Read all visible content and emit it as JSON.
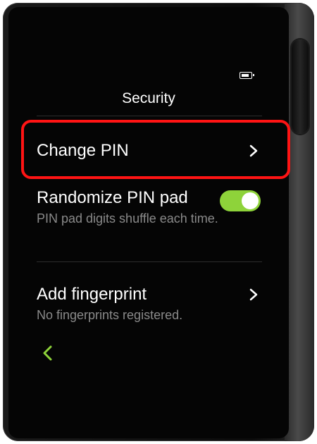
{
  "header": {
    "title": "Security",
    "battery_icon": "battery-icon"
  },
  "settings": {
    "change_pin": {
      "label": "Change PIN",
      "icon": "chevron-right-icon",
      "highlighted": true
    },
    "randomize_pin_pad": {
      "label": "Randomize PIN pad",
      "description": "PIN pad digits shuffle each time.",
      "enabled": true
    },
    "add_fingerprint": {
      "label": "Add fingerprint",
      "description": "No fingerprints registered.",
      "icon": "chevron-right-icon"
    }
  },
  "navigation": {
    "back_icon": "chevron-left-icon"
  },
  "colors": {
    "accent": "#8ed33a",
    "highlight": "#ff1414",
    "background": "#050505",
    "secondary_text": "#8a8a8a"
  }
}
